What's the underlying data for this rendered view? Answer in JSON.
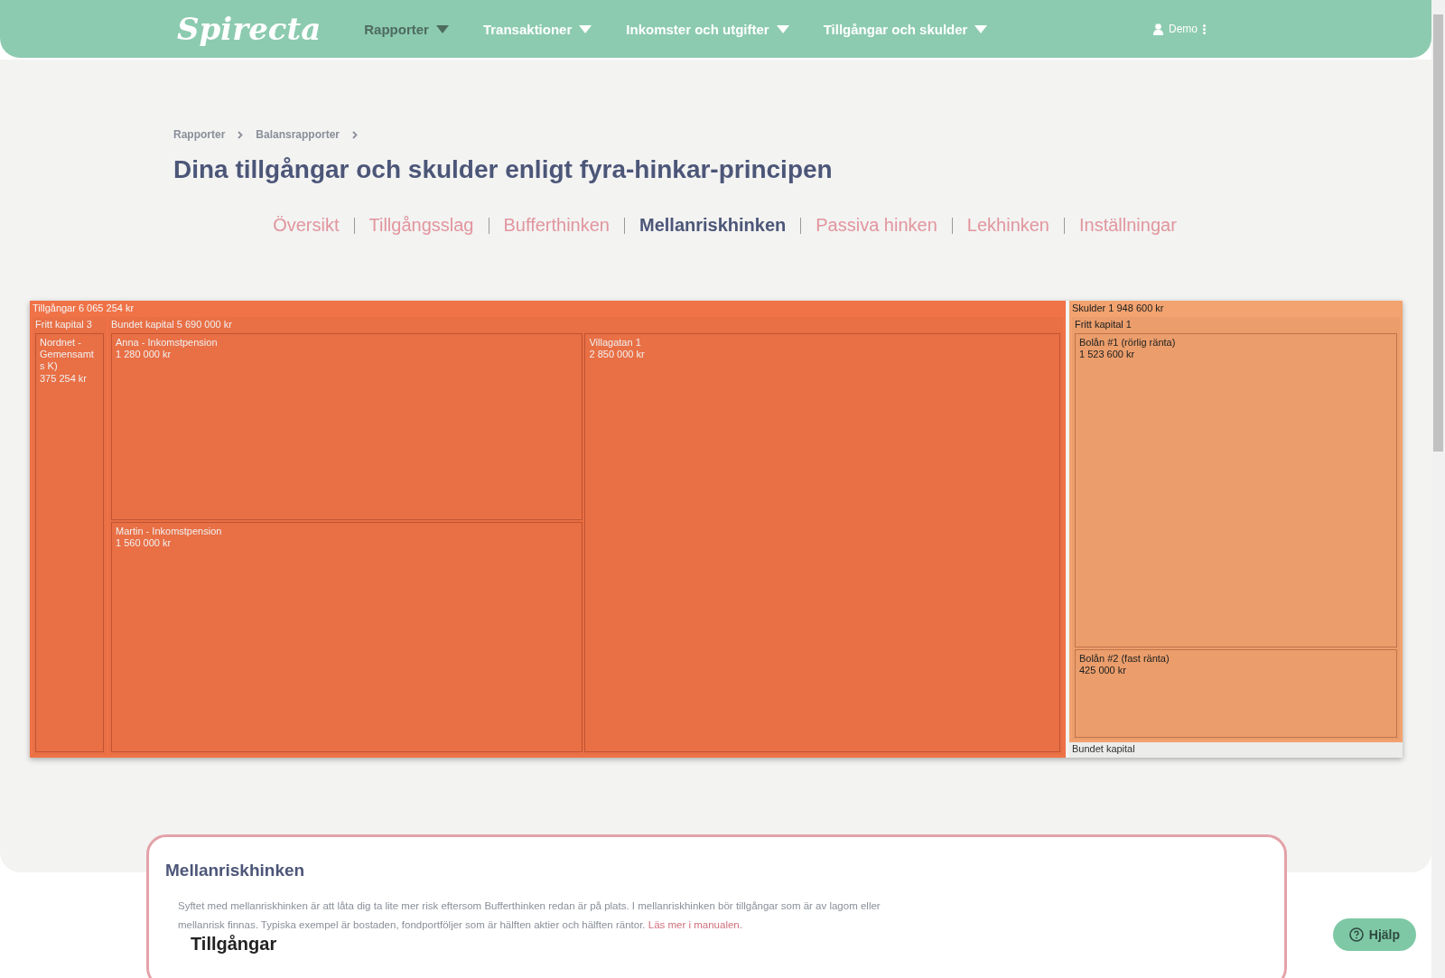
{
  "nav": {
    "logo": "Spirecta",
    "items": [
      {
        "label": "Rapporter",
        "selected": true
      },
      {
        "label": "Transaktioner",
        "selected": false
      },
      {
        "label": "Inkomster och utgifter",
        "selected": false
      },
      {
        "label": "Tillgångar och skulder",
        "selected": false
      }
    ],
    "user": "Demo"
  },
  "breadcrumb": [
    "Rapporter",
    "Balansrapporter"
  ],
  "title": "Dina tillgångar och skulder enligt fyra-hinkar-principen",
  "tabs": [
    {
      "label": "Översikt",
      "selected": false
    },
    {
      "label": "Tillgångsslag",
      "selected": false
    },
    {
      "label": "Bufferthinken",
      "selected": false
    },
    {
      "label": "Mellanriskhinken",
      "selected": true
    },
    {
      "label": "Passiva hinken",
      "selected": false
    },
    {
      "label": "Lekhinken",
      "selected": false
    },
    {
      "label": "Inställningar",
      "selected": false
    }
  ],
  "treemap": [
    {
      "label": "Tillgångar 6 065 254 kr",
      "color": "#f77649",
      "children": [
        {
          "label": "Fritt kapital 3",
          "children": [
            {
              "name": "Nordnet - Gemensamt s K)",
              "value": "375 254 kr"
            }
          ]
        },
        {
          "label": "Bundet kapital 5 690 000 kr",
          "children": [
            {
              "name": "Anna - Inkomstpension",
              "value": "1 280 000 kr"
            },
            {
              "name": "Martin - Inkomstpension",
              "value": "1 560 000 kr"
            },
            {
              "name": "Villagatan 1",
              "value": "2 850 000 kr"
            }
          ]
        }
      ]
    },
    {
      "label": "Skulder 1 948 600 kr",
      "color": "#f9a872",
      "children": [
        {
          "label": "Fritt kapital 1",
          "children": [
            {
              "name": "Bolån #1 (rörlig ränta)",
              "value": "1 523 600 kr"
            },
            {
              "name": "Bolån #2 (fast ränta)",
              "value": "425 000 kr"
            }
          ]
        },
        {
          "name": "Bundet kapital"
        }
      ]
    }
  ],
  "card": {
    "title": "Mellanriskhinken",
    "text": "Syftet med mellanriskhinken är att låta dig ta lite mer risk eftersom Bufferthinken redan är på plats. I mellanriskhinken bör tillgångar som är av lagom eller mellanrisk finnas. Typiska exempel är bostaden, fondportföljer som är hälften aktier och hälften räntor.",
    "link": "Läs mer i manualen.",
    "subtitle": "Tillgångar"
  },
  "help": "Hjälp"
}
